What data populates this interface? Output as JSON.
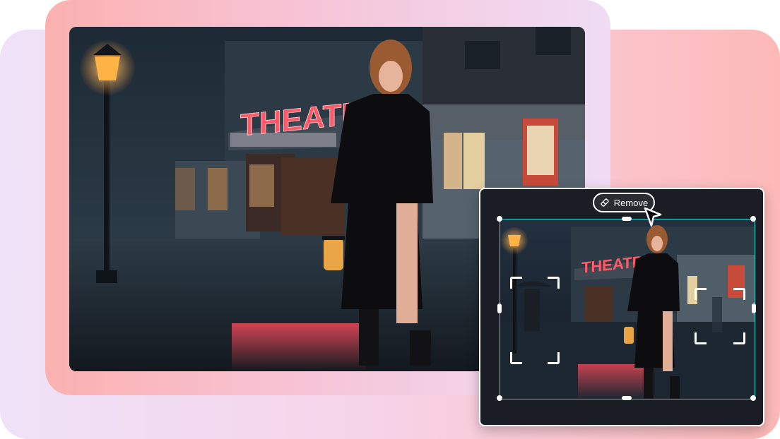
{
  "main_photo": {
    "sign_text": "THEATRE"
  },
  "editor": {
    "remove_label": "Remove",
    "remove_icon": "eraser-icon",
    "cursor_icon": "pointer-cursor-icon",
    "preview_sign_text": "THEATRE",
    "selection_color": "#2ad1cf"
  },
  "colors": {
    "bg_pink": "#fbb1b0",
    "bg_lavender": "#efe2f8",
    "panel_dark": "#1b1d25",
    "neon_red": "#ff4a5a",
    "lamp_orange": "#ffb347"
  }
}
